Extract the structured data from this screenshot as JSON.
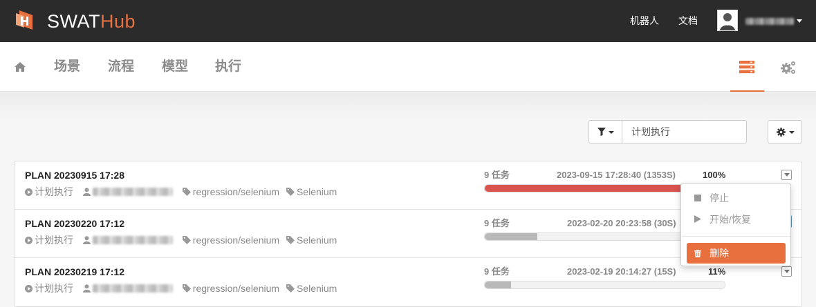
{
  "app": {
    "title_main": "SWAT",
    "title_accent": "Hub",
    "accent_color": "#e8703f",
    "topbar_color": "#2b2b2b"
  },
  "top_nav": {
    "links": [
      "机器人",
      "文档"
    ],
    "user_icon": "avatar-icon",
    "user_menu_icon": "caret-down-icon"
  },
  "main_nav": {
    "home_icon": "home-icon",
    "items": [
      "场景",
      "流程",
      "模型",
      "执行"
    ],
    "active_view_icon": "list-view-icon",
    "settings_icon": "gears-icon"
  },
  "filter": {
    "icon": "filter-icon",
    "value": "计划执行"
  },
  "settings_button_icon": "gear-icon",
  "plans": [
    {
      "title": "PLAN 20230915 17:28",
      "type": "计划执行",
      "tag1": "regression/selenium",
      "tag2": "Selenium",
      "tasks": "9 任务",
      "time": "2023-09-15 17:28:40 (1353S)",
      "percent": "100%",
      "progress": 1.0,
      "progress_color": "#d9534f"
    },
    {
      "title": "PLAN 20230220 17:12",
      "type": "计划执行",
      "tag1": "regression/selenium",
      "tag2": "Selenium",
      "tasks": "9 任务",
      "time": "2023-02-20 20:23:58 (30S)",
      "percent": "",
      "progress": 0.22,
      "progress_color": "#b9b9b9"
    },
    {
      "title": "PLAN 20230219 17:12",
      "type": "计划执行",
      "tag1": "regression/selenium",
      "tag2": "Selenium",
      "tasks": "9 任务",
      "time": "2023-02-19 20:14:27 (15S)",
      "percent": "11%",
      "progress": 0.11,
      "progress_color": "#b9b9b9"
    }
  ],
  "row_menu": {
    "stop": "停止",
    "start_resume": "开始/恢复",
    "delete": "删除",
    "stop_icon": "stop-icon",
    "play_icon": "play-icon",
    "trash_icon": "trash-icon"
  }
}
